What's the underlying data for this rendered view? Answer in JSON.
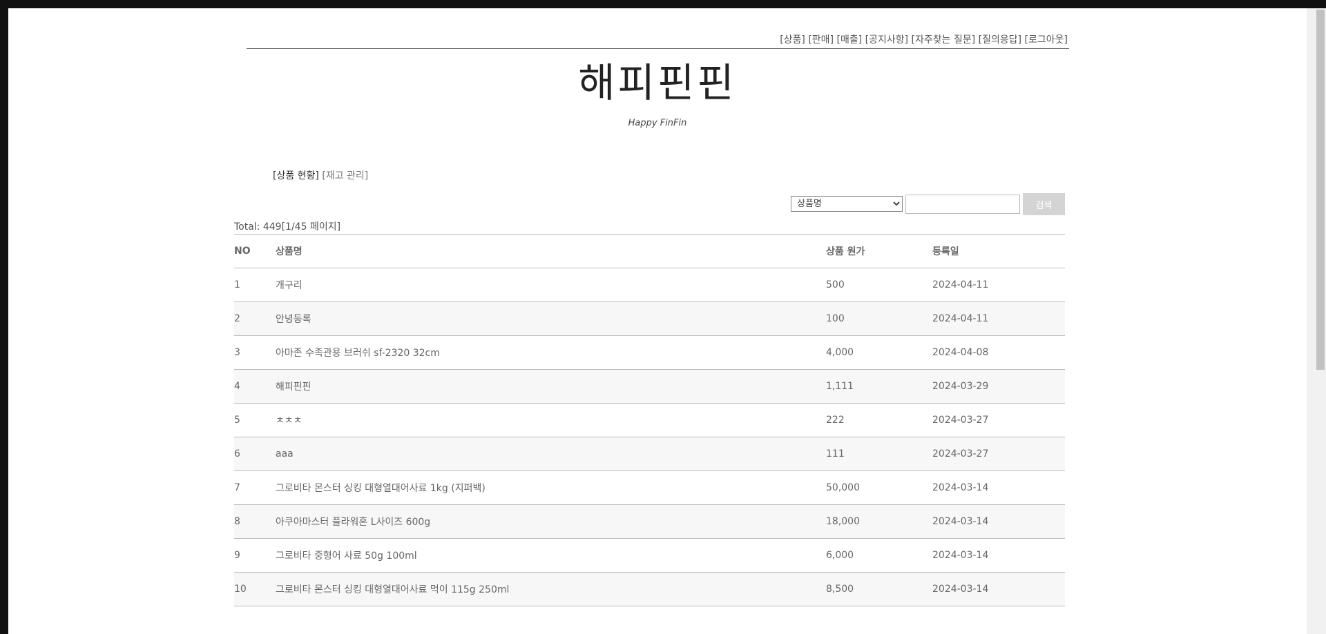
{
  "site": {
    "title": "해피핀핀",
    "subtitle": "Happy FinFin"
  },
  "topnav": [
    "[상품]",
    "[판매]",
    "[매출]",
    "[공지사항]",
    "[자주찾는 질문]",
    "[질의응답]",
    "[로그아웃]"
  ],
  "subnav": {
    "active": "[상품 현황]",
    "inactive": "[재고 관리]"
  },
  "search": {
    "select_value": "상품명",
    "input_value": "",
    "button": "검색"
  },
  "total": "Total: 449[1/45 페이지]",
  "table": {
    "headers": [
      "NO",
      "상품명",
      "상품 원가",
      "등록일"
    ],
    "rows": [
      [
        "1",
        "개구리",
        "500",
        "2024-04-11"
      ],
      [
        "2",
        "안녕등록",
        "100",
        "2024-04-11"
      ],
      [
        "3",
        "아마존 수족관용 브러쉬 sf-2320 32cm",
        "4,000",
        "2024-04-08"
      ],
      [
        "4",
        "해피핀핀",
        "1,111",
        "2024-03-29"
      ],
      [
        "5",
        "ㅊㅊㅊ",
        "222",
        "2024-03-27"
      ],
      [
        "6",
        "aaa",
        "111",
        "2024-03-27"
      ],
      [
        "7",
        "그로비타 몬스터 싱킹 대형열대어사료 1kg (지퍼백)",
        "50,000",
        "2024-03-14"
      ],
      [
        "8",
        "아쿠아마스터 플라워혼 L사이즈 600g",
        "18,000",
        "2024-03-14"
      ],
      [
        "9",
        "그로비타 중형어 사료 50g 100ml",
        "6,000",
        "2024-03-14"
      ],
      [
        "10",
        "그로비타 몬스터 싱킹 대형열대어사료 먹이 115g 250ml",
        "8,500",
        "2024-03-14"
      ]
    ]
  }
}
